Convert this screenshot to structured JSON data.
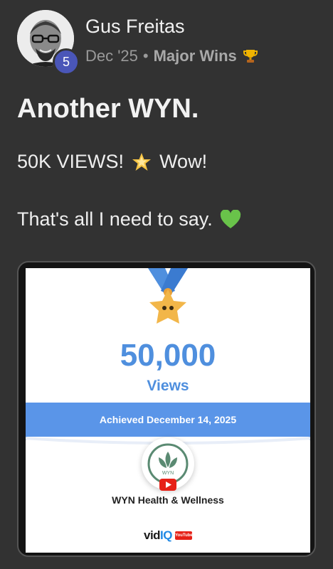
{
  "post": {
    "author": "Gus Freitas",
    "level": "5",
    "date": "Dec '25",
    "separator": "•",
    "category": "Major Wins",
    "category_icon": "trophy-icon",
    "title": "Another WYN.",
    "body_line1_a": "50K VIEWS!",
    "body_line1_icon": "sparkle-star-icon",
    "body_line1_b": "Wow!",
    "body_line2": "That's all I need to say.",
    "body_line2_icon": "green-heart-icon"
  },
  "card": {
    "views_number": "50,000",
    "views_label": "Views",
    "achieved_text": "Achieved December 14, 2025",
    "channel_name": "WYN Health & Wellness",
    "branding_part1": "vid",
    "branding_part2": "IQ",
    "youtube_tiny": "YouTube"
  },
  "colors": {
    "background": "#323232",
    "accent_blue": "#4f8fde",
    "level_badge": "#4a56b8",
    "ribbon": "#5a95e8",
    "youtube_red": "#e62117"
  }
}
